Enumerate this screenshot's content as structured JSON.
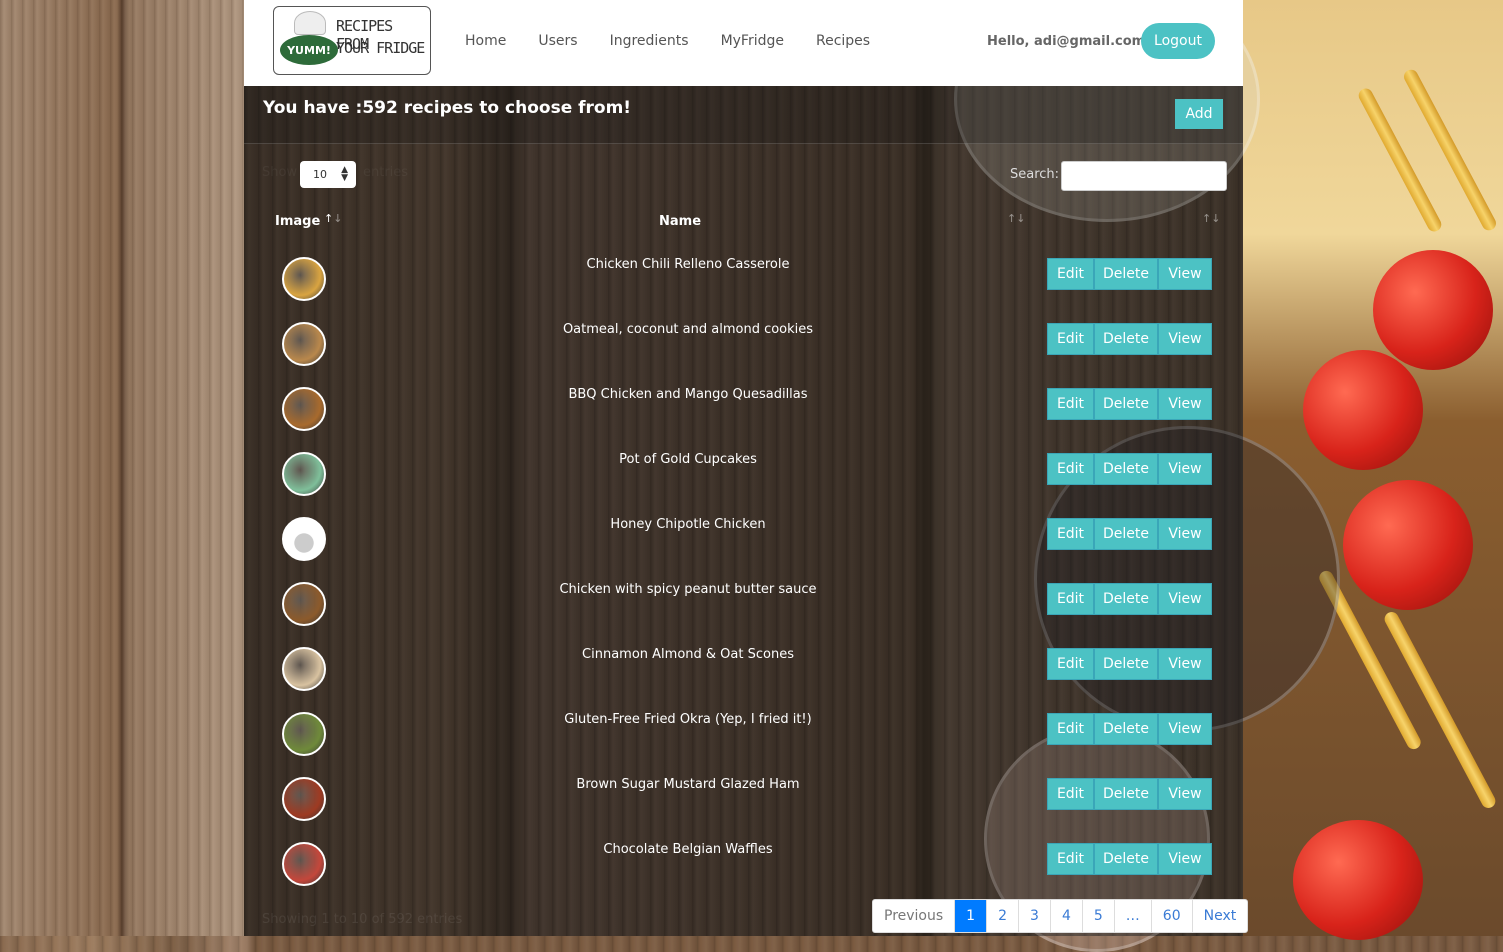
{
  "brand": {
    "logo_badge": "YUMM!",
    "logo_line1": "RECIPES FROM",
    "logo_line2": "YOUR FRIDGE"
  },
  "nav": {
    "links": [
      "Home",
      "Users",
      "Ingredients",
      "MyFridge",
      "Recipes"
    ],
    "greeting": "Hello, adi@gmail.com!",
    "logout_label": "Logout"
  },
  "header": {
    "title": "You have :592 recipes to choose from!",
    "add_label": "Add"
  },
  "controls": {
    "show_label": "Show",
    "page_size": "10",
    "entries_label": "entries",
    "search_label": "Search:",
    "search_value": ""
  },
  "table": {
    "columns": [
      "Image",
      "Name"
    ],
    "rows": [
      {
        "name": "Chicken Chili Relleno Casserole",
        "thumb": "#d9a441"
      },
      {
        "name": "Oatmeal, coconut and almond cookies",
        "thumb": "#b9884c"
      },
      {
        "name": "BBQ Chicken and Mango Quesadillas",
        "thumb": "#a86a2d"
      },
      {
        "name": "Pot of Gold Cupcakes",
        "thumb": "#7fbf9a"
      },
      {
        "name": "Honey Chipotle Chicken",
        "thumb": "#ffffff"
      },
      {
        "name": "Chicken with spicy peanut butter sauce",
        "thumb": "#8c5a2b"
      },
      {
        "name": "Cinnamon Almond & Oat Scones",
        "thumb": "#d8c2a0"
      },
      {
        "name": "Gluten-Free Fried Okra (Yep, I fried it!)",
        "thumb": "#6f8a3a"
      },
      {
        "name": "Brown Sugar Mustard Glazed Ham",
        "thumb": "#9e3a22"
      },
      {
        "name": "Chocolate Belgian Waffles",
        "thumb": "#c4473b"
      }
    ],
    "actions": {
      "edit": "Edit",
      "delete": "Delete",
      "view": "View"
    }
  },
  "footer": {
    "info": "Showing 1 to 10 of 592 entries",
    "pagination": [
      "Previous",
      "1",
      "2",
      "3",
      "4",
      "5",
      "…",
      "60",
      "Next"
    ],
    "active_page": "1"
  },
  "colors": {
    "accent": "#4cc2c4",
    "active_page": "#007bff"
  }
}
